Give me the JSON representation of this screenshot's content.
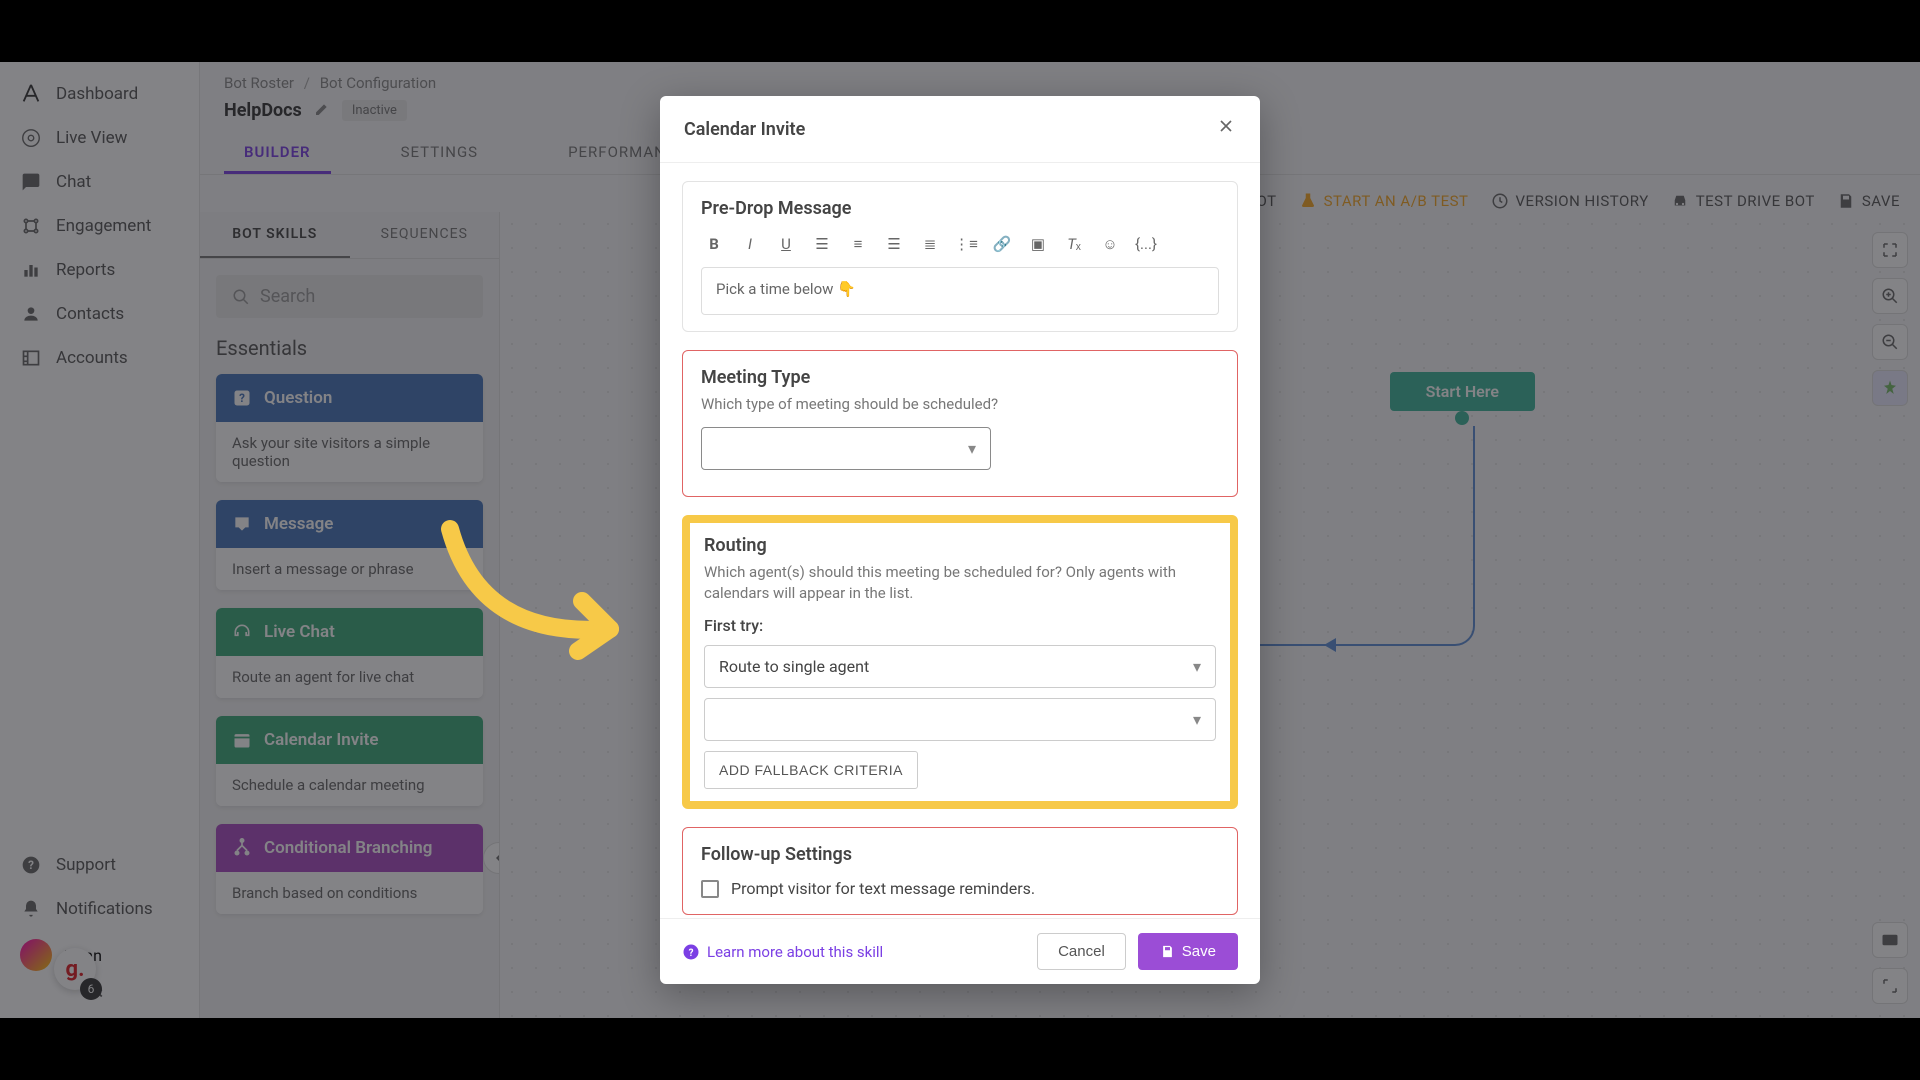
{
  "sidebar": {
    "items": [
      {
        "label": "Dashboard",
        "icon": "logo"
      },
      {
        "label": "Live View",
        "icon": "eye"
      },
      {
        "label": "Chat",
        "icon": "chat"
      },
      {
        "label": "Engagement",
        "icon": "engagement"
      },
      {
        "label": "Reports",
        "icon": "reports"
      },
      {
        "label": "Contacts",
        "icon": "contacts"
      },
      {
        "label": "Accounts",
        "icon": "accounts"
      }
    ],
    "bottom": [
      {
        "label": "Support",
        "icon": "help"
      },
      {
        "label": "Notifications",
        "icon": "bell"
      }
    ],
    "user": {
      "name": "Ngan"
    },
    "g_badge": "g.",
    "badge_count": "6"
  },
  "breadcrumb": {
    "root": "Bot Roster",
    "current": "Bot Configuration"
  },
  "page": {
    "title": "HelpDocs",
    "status": "Inactive"
  },
  "tabs": [
    "BUILDER",
    "SETTINGS",
    "PERFORMANCE"
  ],
  "active_tab": 0,
  "toolbar": {
    "archive": "ARCHIVE BOT",
    "abtest": "START AN A/B TEST",
    "history": "VERSION HISTORY",
    "testdrive": "TEST DRIVE BOT",
    "save": "SAVE"
  },
  "skills": {
    "tabs": [
      "BOT SKILLS",
      "SEQUENCES"
    ],
    "active_tab": 0,
    "search_placeholder": "Search",
    "section_header": "Essentials",
    "cards": [
      {
        "title": "Question",
        "desc": "Ask your site visitors a simple question",
        "color": "sk-question"
      },
      {
        "title": "Message",
        "desc": "Insert a message or phrase",
        "color": "sk-message"
      },
      {
        "title": "Live Chat",
        "desc": "Route an agent for live chat",
        "color": "sk-livechat"
      },
      {
        "title": "Calendar Invite",
        "desc": "Schedule a calendar meeting",
        "color": "sk-calendar"
      },
      {
        "title": "Conditional Branching",
        "desc": "Branch based on conditions",
        "color": "sk-branch"
      }
    ]
  },
  "canvas": {
    "start_label": "Start Here"
  },
  "modal": {
    "title": "Calendar Invite",
    "predrop": {
      "title": "Pre-Drop Message",
      "message": "Pick a time below 👇"
    },
    "meeting_type": {
      "title": "Meeting Type",
      "sub": "Which type of meeting should be scheduled?",
      "value": ""
    },
    "routing": {
      "title": "Routing",
      "sub": "Which agent(s) should this meeting be scheduled for? Only agents with calendars will appear in the list.",
      "first_try_label": "First try:",
      "route_method": "Route to single agent",
      "agent_value": "",
      "add_fallback": "ADD FALLBACK CRITERIA"
    },
    "followup": {
      "title": "Follow-up Settings",
      "checkbox_label": "Prompt visitor for text message reminders."
    },
    "learn_more": "Learn more about this skill",
    "cancel": "Cancel",
    "save": "Save"
  }
}
